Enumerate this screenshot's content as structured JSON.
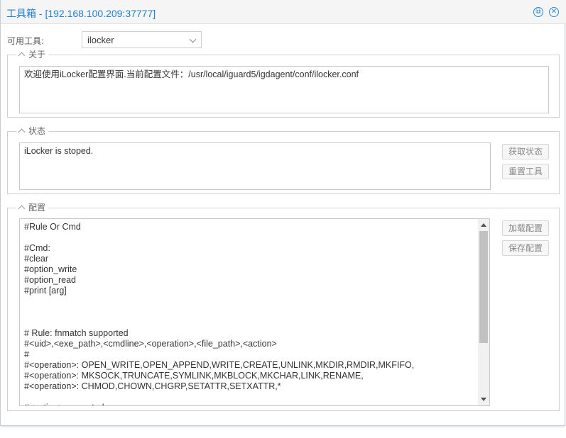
{
  "window": {
    "title": "工具箱 - [192.168.100.209:37777]",
    "restore_icon": "restore-icon",
    "close_icon": "close-icon"
  },
  "tool_select": {
    "label": "可用工具:",
    "value": "ilocker"
  },
  "about": {
    "legend": "关于",
    "text": "欢迎使用iLocker配置界面.当前配置文件：/usr/local/iguard5/igdagent/conf/ilocker.conf"
  },
  "status": {
    "legend": "状态",
    "text": "iLocker is stoped.",
    "get_status_label": "获取状态",
    "reset_tool_label": "重置工具"
  },
  "config": {
    "legend": "配置",
    "load_label": "加载配置",
    "save_label": "保存配置",
    "lines": [
      "#Rule Or Cmd",
      "",
      "#Cmd:",
      "#clear",
      "#option_write",
      "#option_read",
      "#print [arg]",
      "",
      "",
      "",
      "# Rule: fnmatch supported",
      "#<uid>,<exe_path>,<cmdline>,<operation>,<file_path>,<action>",
      "#",
      "#<operation>: OPEN_WRITE,OPEN_APPEND,WRITE,CREATE,UNLINK,MKDIR,RMDIR,MKFIFO,",
      "#<operation>: MKSOCK,TRUNCATE,SYMLINK,MKBLOCK,MKCHAR,LINK,RENAME,",
      "#<operation>: CHMOD,CHOWN,CHGRP,SETATTR,SETXATTR,*",
      "",
      "#<action>: accept, drop"
    ]
  },
  "colors": {
    "accent": "#1f7fd0",
    "border": "#d0d0d0"
  }
}
